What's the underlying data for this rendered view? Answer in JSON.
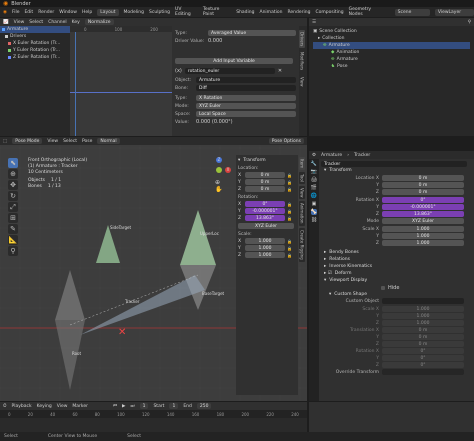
{
  "window": {
    "title": "Blender"
  },
  "menu": [
    "File",
    "Edit",
    "Render",
    "Window",
    "Help"
  ],
  "workspaces": [
    "Layout",
    "Modeling",
    "Sculpting",
    "UV Editing",
    "Texture Paint",
    "Shading",
    "Animation",
    "Rendering",
    "Compositing",
    "Geometry Nodes"
  ],
  "scene_label": "Scene",
  "viewlayer_label": "ViewLayer",
  "graph": {
    "menu": [
      "View",
      "Select",
      "Channel",
      "Key"
    ],
    "mode": "Normalize",
    "frames": [
      "0",
      "100",
      "200",
      "300",
      "400"
    ],
    "channels": [
      {
        "label": "Armature",
        "color": "#5aa0ff"
      },
      {
        "label": "Drivers",
        "color": "#cccccc"
      },
      {
        "label": "X Euler Rotation (Tr...",
        "color": "#e06666"
      },
      {
        "label": "Y Euler Rotation (Tr...",
        "color": "#7bd36b"
      },
      {
        "label": "Z Euler Rotation (Tr...",
        "color": "#6b8bff"
      }
    ]
  },
  "driver": {
    "type_label": "Type:",
    "type_value": "Averaged Value",
    "value_label": "Driver Value:",
    "value": "0.000",
    "add_input": "Add Input Variable",
    "var_name": "rotation_euler",
    "object_label": "Object:",
    "object_value": "Armature",
    "bone_label": "Bone:",
    "bone_value": "Diff",
    "vtype_label": "Type:",
    "vtype_value": "X Rotation",
    "mode_label": "Mode:",
    "mode_value": "XYZ Euler",
    "space_label": "Space:",
    "space_value": "Local Space",
    "result_label": "Value:",
    "result_value": "0.000 (0.000°)",
    "tabs": [
      "Drivers",
      "Modifiers",
      "View"
    ]
  },
  "outliner": {
    "title": "Scene Collection",
    "items": [
      "Collection",
      "Armature",
      "Animation",
      "Armature",
      "Pose"
    ]
  },
  "viewport": {
    "mode": "Pose Mode",
    "menu": [
      "View",
      "Select",
      "Pose"
    ],
    "orientation": "Normal",
    "options": "Pose Options",
    "info": [
      "Front Orthographic (Local)",
      "(1) Armature : Tracker",
      "10 Centimeters"
    ],
    "stats": [
      {
        "k": "Objects",
        "v": "1 / 1"
      },
      {
        "k": "Bones",
        "v": "1 / 13"
      }
    ],
    "bones": [
      "SidеTarget",
      "UpperLoc",
      "Tracker",
      "BaseTarget",
      "Root"
    ],
    "axis": [
      "X",
      "Y",
      "Z"
    ],
    "vtabs": [
      "Item",
      "Tool",
      "View",
      "Animation",
      "Create Rigging"
    ]
  },
  "npanel": {
    "title": "Transform",
    "location_label": "Location:",
    "location": [
      {
        "axis": "X",
        "value": "0 m"
      },
      {
        "axis": "Y",
        "value": "0 m"
      },
      {
        "axis": "Z",
        "value": "0 m"
      }
    ],
    "rotation_label": "Rotation:",
    "rotation": [
      {
        "axis": "X",
        "value": "0°"
      },
      {
        "axis": "Y",
        "value": "-0.000001°"
      },
      {
        "axis": "Z",
        "value": "13.863°"
      }
    ],
    "rotation_mode": "XYZ Euler",
    "scale_label": "Scale:",
    "scale": [
      {
        "axis": "X",
        "value": "1.000"
      },
      {
        "axis": "Y",
        "value": "1.000"
      },
      {
        "axis": "Z",
        "value": "1.000"
      }
    ]
  },
  "properties": {
    "breadcrumb": [
      "Armature",
      "Tracker"
    ],
    "bone_name": "Tracker",
    "transform_title": "Transform",
    "location_label": "Location X",
    "location": [
      {
        "axis": "Location X",
        "value": "0 m"
      },
      {
        "axis": "Y",
        "value": "0 m"
      },
      {
        "axis": "Z",
        "value": "0 m"
      }
    ],
    "rotation": [
      {
        "axis": "Rotation X",
        "value": "0°"
      },
      {
        "axis": "Y",
        "value": "-0.000001°"
      },
      {
        "axis": "Z",
        "value": "13.863°"
      }
    ],
    "mode_label": "Mode",
    "mode_value": "XYZ Euler",
    "scale": [
      {
        "axis": "Scale X",
        "value": "1.000"
      },
      {
        "axis": "Y",
        "value": "1.000"
      },
      {
        "axis": "Z",
        "value": "1.000"
      }
    ],
    "sections": [
      "Bendy Bones",
      "Relations",
      "Inverse Kinematics",
      "Deform",
      "Viewport Display"
    ],
    "hide_label": "Hide",
    "custom_shape": "Custom Shape",
    "custom_object_label": "Custom Object",
    "shape_fields": [
      {
        "k": "Scale X",
        "v": "1.000"
      },
      {
        "k": "Y",
        "v": "1.000"
      },
      {
        "k": "Z",
        "v": "1.000"
      },
      {
        "k": "Translation X",
        "v": "0 m"
      },
      {
        "k": "Y",
        "v": "0 m"
      },
      {
        "k": "Z",
        "v": "0 m"
      },
      {
        "k": "Rotation X",
        "v": "0°"
      },
      {
        "k": "Y",
        "v": "0°"
      },
      {
        "k": "Z",
        "v": "0°"
      }
    ],
    "override_label": "Override Transform"
  },
  "timeline": {
    "menu": [
      "Playback",
      "Keying",
      "View",
      "Marker"
    ],
    "current": "1",
    "start_label": "Start",
    "start": "1",
    "end_label": "End",
    "end": "250",
    "ticks": [
      "0",
      "20",
      "40",
      "60",
      "80",
      "100",
      "120",
      "140",
      "160",
      "180",
      "200",
      "220",
      "240"
    ]
  },
  "status": {
    "left": "Select",
    "mid": "Center View to Mouse",
    "right": "Select"
  },
  "colors": {
    "accent": "#4772b3",
    "purple": "#7b3fb3",
    "header": "#303030"
  }
}
